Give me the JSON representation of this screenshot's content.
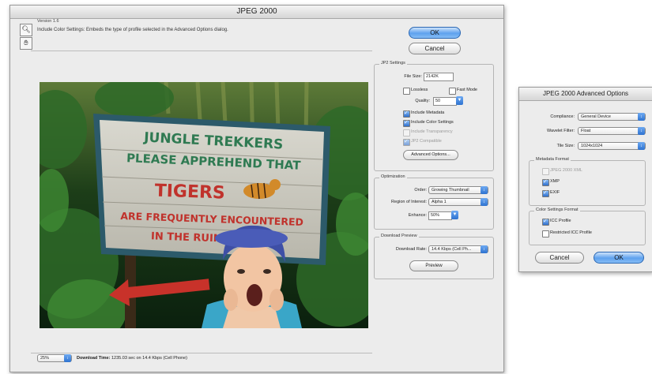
{
  "main_dialog": {
    "title": "JPEG 2000",
    "version": "Version 1.6",
    "description": "Include Color Settings: Embeds the type of profile selected in the Advanced Options dialog.",
    "ok_label": "OK",
    "cancel_label": "Cancel",
    "jp2_settings": {
      "title": "JP2 Settings",
      "file_size_label": "File Size:",
      "file_size_value": "2142",
      "file_size_unit": "K",
      "lossless_label": "Lossless",
      "lossless_checked": false,
      "fast_mode_label": "Fast Mode",
      "fast_mode_checked": false,
      "quality_label": "Quality:",
      "quality_value": "50",
      "include_metadata_label": "Include Metadata",
      "include_metadata_checked": true,
      "include_color_settings_label": "Include Color Settings",
      "include_color_settings_checked": true,
      "include_transparency_label": "Include Transparency",
      "include_transparency_checked": false,
      "jp2_compatible_label": "JP2 Compatible",
      "jp2_compatible_checked": true,
      "advanced_options_label": "Advanced Options..."
    },
    "optimization": {
      "title": "Optimization",
      "order_label": "Order:",
      "order_value": "Growing Thumbnail",
      "roi_label": "Region of Interest:",
      "roi_value": "Alpha 1",
      "enhance_label": "Enhance:",
      "enhance_value": "50%"
    },
    "download_preview": {
      "title": "Download Preview",
      "rate_label": "Download Rate:",
      "rate_value": "14.4 Kbps (Cell Ph...",
      "preview_label": "Preview"
    },
    "preview_image": {
      "sign_line1": "JUNGLE TREKKERS",
      "sign_line2": "PLEASE APPREHEND THAT",
      "sign_line3": "TIGERS",
      "sign_line4": "ARE FREQUENTLY ENCOUNTERED",
      "sign_line5": "IN THE RUINS AHEAD"
    },
    "status_bar": {
      "zoom": "25%",
      "download_time_label": "Download Time:",
      "download_time_value": "1235.03 sec on 14.4 Kbps (Cell Phone)"
    },
    "icons": {
      "zoom": "magnifier-icon",
      "hand": "hand-icon"
    }
  },
  "advanced_dialog": {
    "title": "JPEG 2000 Advanced Options",
    "compliance_label": "Compliance:",
    "compliance_value": "General Device",
    "wavelet_label": "Wavelet Filter:",
    "wavelet_value": "Float",
    "tile_size_label": "Tile Size:",
    "tile_size_value": "1024x1024",
    "metadata_format": {
      "title": "Metadata Format",
      "jpeg2000_label": "JPEG 2000 XML",
      "jpeg2000_checked": false,
      "xmp_label": "XMP",
      "xmp_checked": true,
      "exif_label": "EXIF",
      "exif_checked": true
    },
    "color_settings_format": {
      "title": "Color Settings Format",
      "icc_label": "ICC Profile",
      "icc_checked": true,
      "restricted_label": "Restricted ICC Profile",
      "restricted_checked": false
    },
    "cancel_label": "Cancel",
    "ok_label": "OK"
  },
  "colors": {
    "dialog_bg": "#ececec",
    "aqua_blue": "#5ea1ee",
    "sign_green": "#2f7a52",
    "sign_red": "#c0322c"
  }
}
